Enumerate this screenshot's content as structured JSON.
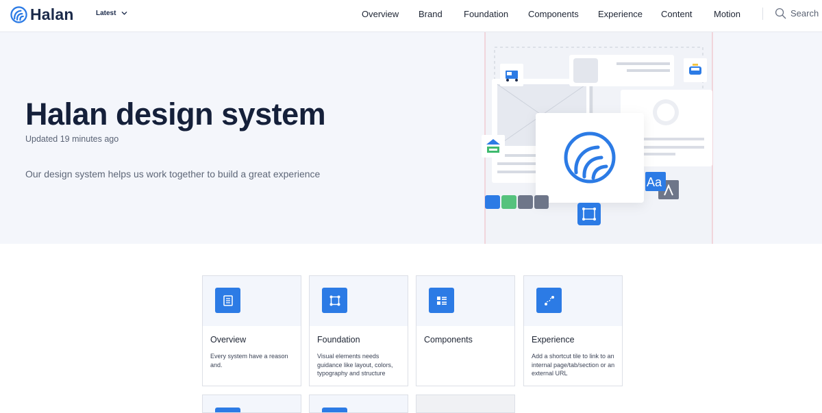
{
  "app": {
    "logo_text": "Halan",
    "version_label": "Latest",
    "brand_color": "#2c7be5"
  },
  "nav": {
    "items": [
      "Overview",
      "Brand",
      "Foundation",
      "Components",
      "Experience",
      "Content",
      "Motion"
    ],
    "search_label": "Search"
  },
  "hero": {
    "title": "Halan design system",
    "updated": "Updated 19 minutes ago",
    "description": "Our design system helps us work together to build a great experience",
    "illustration_text": {
      "typography_glyph": "Aa"
    }
  },
  "tiles": [
    {
      "title": "Overview",
      "description": "Every system have a reason and.",
      "icon": "document-icon"
    },
    {
      "title": "Foundation",
      "description": "Visual elements needs guidance like layout, colors, typography and structure",
      "icon": "frame-icon"
    },
    {
      "title": "Components",
      "description": "",
      "icon": "list-icon"
    },
    {
      "title": "Experience",
      "description": "Add a shortcut tile to link to an internal page/tab/section or an external URL",
      "icon": "path-icon"
    }
  ]
}
